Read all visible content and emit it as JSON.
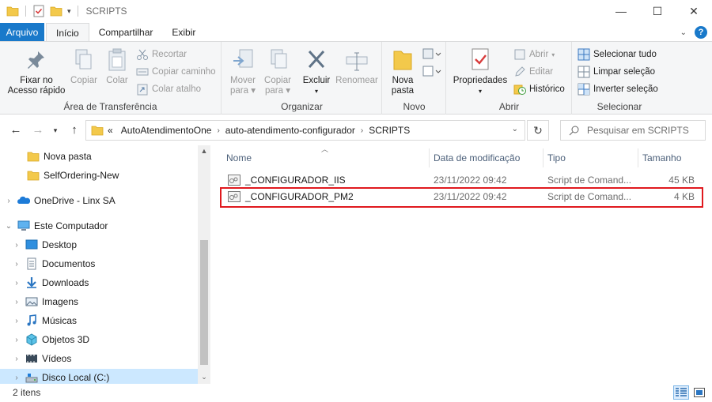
{
  "window": {
    "title": "SCRIPTS",
    "minimize": "—",
    "maximize": "☐",
    "close": "✕"
  },
  "ribbon_tabs": {
    "file": "Arquivo",
    "home": "Início",
    "share": "Compartilhar",
    "view": "Exibir"
  },
  "ribbon": {
    "clipboard": {
      "label": "Área de Transferência",
      "pin_line1": "Fixar no",
      "pin_line2": "Acesso rápido",
      "copy": "Copiar",
      "paste": "Colar",
      "cut": "Recortar",
      "copy_path": "Copiar caminho",
      "paste_shortcut": "Colar atalho"
    },
    "organize": {
      "label": "Organizar",
      "move_line1": "Mover",
      "move_line2": "para",
      "copyto_line1": "Copiar",
      "copyto_line2": "para",
      "delete": "Excluir",
      "rename": "Renomear"
    },
    "new": {
      "label": "Novo",
      "folder_line1": "Nova",
      "folder_line2": "pasta"
    },
    "open": {
      "label": "Abrir",
      "properties": "Propriedades",
      "open": "Abrir",
      "edit": "Editar",
      "history": "Histórico"
    },
    "select": {
      "label": "Selecionar",
      "all": "Selecionar tudo",
      "none": "Limpar seleção",
      "invert": "Inverter seleção"
    }
  },
  "address": {
    "overflow": "«",
    "crumbs": [
      "AutoAtendimentoOne",
      "auto-atendimento-configurador",
      "SCRIPTS"
    ],
    "search_placeholder": "Pesquisar em SCRIPTS"
  },
  "nav": {
    "items": [
      {
        "label": "Nova pasta",
        "icon": "folder-icon"
      },
      {
        "label": "SelfOrdering-New",
        "icon": "folder-icon"
      },
      {
        "label": "OneDrive - Linx SA",
        "icon": "onedrive-icon"
      },
      {
        "label": "Este Computador",
        "icon": "computer-icon"
      },
      {
        "label": "Desktop",
        "icon": "desktop-icon"
      },
      {
        "label": "Documentos",
        "icon": "documents-icon"
      },
      {
        "label": "Downloads",
        "icon": "downloads-icon"
      },
      {
        "label": "Imagens",
        "icon": "pictures-icon"
      },
      {
        "label": "Músicas",
        "icon": "music-icon"
      },
      {
        "label": "Objetos 3D",
        "icon": "objects3d-icon"
      },
      {
        "label": "Vídeos",
        "icon": "videos-icon"
      },
      {
        "label": "Disco Local (C:)",
        "icon": "drive-icon"
      }
    ]
  },
  "files": {
    "columns": {
      "name": "Nome",
      "modified": "Data de modificação",
      "type": "Tipo",
      "size": "Tamanho"
    },
    "rows": [
      {
        "name": "_CONFIGURADOR_IIS",
        "modified": "23/11/2022 09:42",
        "type": "Script de Comand...",
        "size": "45 KB"
      },
      {
        "name": "_CONFIGURADOR_PM2",
        "modified": "23/11/2022 09:42",
        "type": "Script de Comand...",
        "size": "4 KB"
      }
    ]
  },
  "status": {
    "count": "2 itens"
  },
  "colors": {
    "accent": "#1979ca",
    "highlight_box": "#e0191e",
    "selection": "#cce8ff"
  }
}
